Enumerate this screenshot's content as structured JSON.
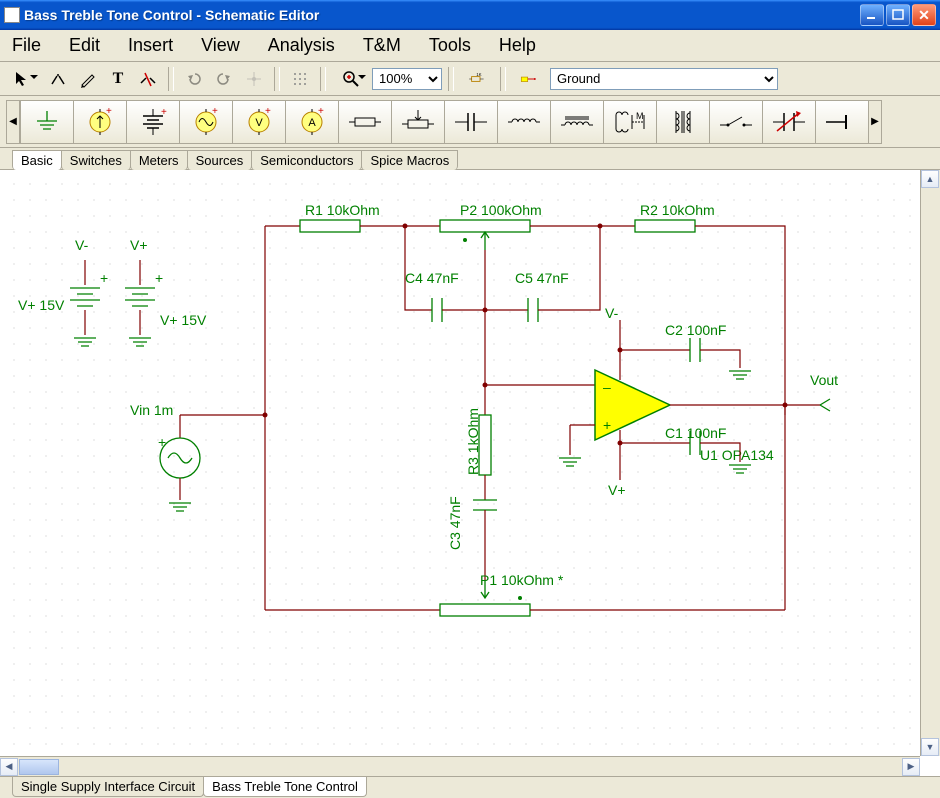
{
  "window": {
    "title": "Bass Treble Tone Control - Schematic Editor"
  },
  "menu": {
    "items": [
      "File",
      "Edit",
      "Insert",
      "View",
      "Analysis",
      "T&M",
      "Tools",
      "Help"
    ]
  },
  "toolbar1": {
    "zoom_value": "100%",
    "net_label": "Ground"
  },
  "categories": [
    "Basic",
    "Switches",
    "Meters",
    "Sources",
    "Semiconductors",
    "Spice Macros"
  ],
  "bottom_tabs": [
    "Single Supply Interface Circuit",
    "Bass Treble Tone Control"
  ],
  "schematic": {
    "labels": {
      "vminus_top": "V-",
      "vplus_top": "V+",
      "vplus15_left": "V+ 15V",
      "vplus15_right": "V+ 15V",
      "vin": "Vin 1m",
      "r1": "R1 10kOhm",
      "p2": "P2 100kOhm",
      "r2": "R2 10kOhm",
      "c4": "C4 47nF",
      "c5": "C5 47nF",
      "c2": "C2 100nF",
      "c1": "C1 100nF",
      "u1": "U1 OPA134",
      "r3": "R3 1kOhm",
      "c3": "C3 47nF",
      "p1": "P1 10kOhm *",
      "vout": "Vout",
      "opamp_vminus": "V-",
      "opamp_vplus": "V+",
      "opamp_minus": "–",
      "opamp_plus": "+",
      "battplus1": "+",
      "battplus2": "+",
      "srcplus": "+"
    }
  }
}
